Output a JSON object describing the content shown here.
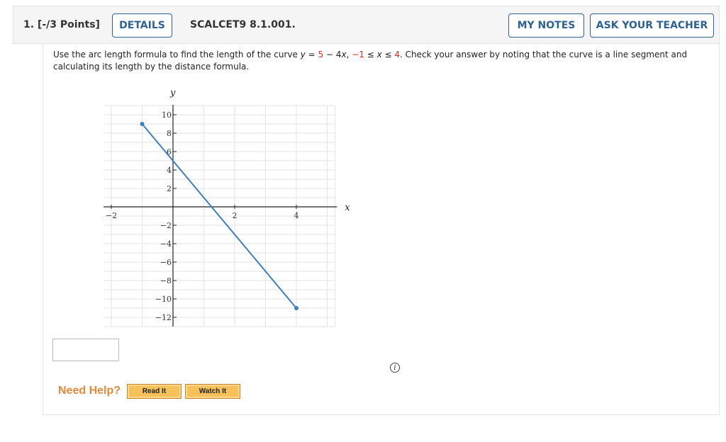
{
  "header": {
    "question_number": "1.  [-/3 Points]",
    "details_label": "DETAILS",
    "problem_code": "SCALCET9 8.1.001.",
    "my_notes_label": "MY NOTES",
    "ask_teacher_label": "ASK YOUR TEACHER"
  },
  "prompt": {
    "part1": "Use the arc length formula to find the length of the curve ",
    "y": "y",
    "eq": " = ",
    "five": "5",
    "minus4x": " − 4",
    "x": "x",
    "comma": ", ",
    "neg1": "−1",
    "le1": " ≤ ",
    "x2": "x",
    "le2": " ≤ ",
    "four": "4",
    "part2": ". Check your answer by noting that the curve is a line segment and calculating its length by the distance formula."
  },
  "graph": {
    "x_label": "x",
    "y_label": "y",
    "x_ticks": [
      {
        "v": -2,
        "t": "−2"
      },
      {
        "v": 2,
        "t": "2"
      },
      {
        "v": 4,
        "t": "4"
      }
    ],
    "y_ticks": [
      {
        "v": 10,
        "t": "10"
      },
      {
        "v": 8,
        "t": "8"
      },
      {
        "v": 6,
        "t": "6"
      },
      {
        "v": 4,
        "t": "4"
      },
      {
        "v": 2,
        "t": "2"
      },
      {
        "v": -2,
        "t": "−2"
      },
      {
        "v": -4,
        "t": "−4"
      },
      {
        "v": -6,
        "t": "−6"
      },
      {
        "v": -8,
        "t": "−8"
      },
      {
        "v": -10,
        "t": "−10"
      },
      {
        "v": -12,
        "t": "−12"
      }
    ],
    "x_range": [
      -2.25,
      5.25
    ],
    "y_range": [
      -13,
      11
    ],
    "segment": {
      "x1": -1,
      "y1": 9,
      "x2": 4,
      "y2": -11
    },
    "line_color": "#3d7fc4",
    "info_label": "i"
  },
  "answer": {
    "value": ""
  },
  "help": {
    "need_help": "Need Help?",
    "read_it": "Read It",
    "watch_it": "Watch It"
  }
}
